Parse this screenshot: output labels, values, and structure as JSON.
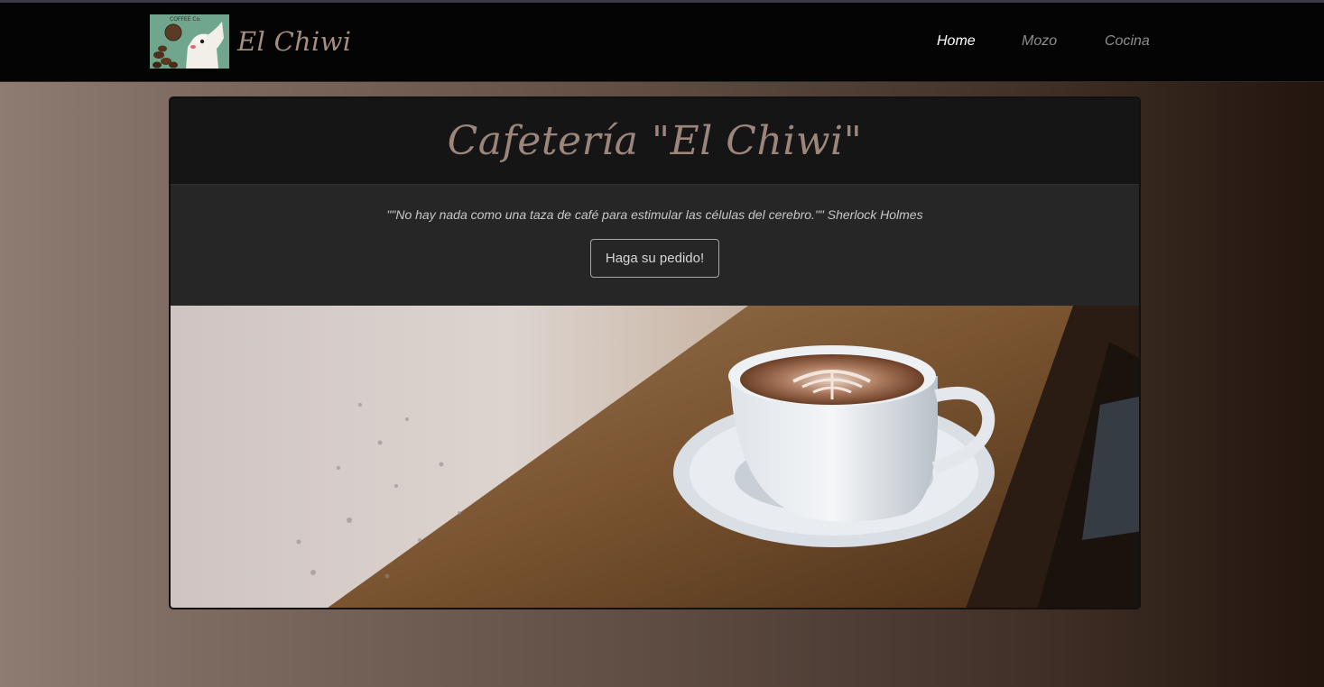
{
  "navbar": {
    "brand": "El Chiwi",
    "logo_text": "COFFEE Co.",
    "links": [
      {
        "label": "Home",
        "active": true
      },
      {
        "label": "Mozo",
        "active": false
      },
      {
        "label": "Cocina",
        "active": false
      }
    ]
  },
  "card": {
    "title": "Cafetería \"El Chiwi\"",
    "quote": "\"\"No hay nada como una taza de café para estimular las células del cerebro.\"\" Sherlock Holmes",
    "button_label": "Haga su pedido!",
    "hero_image": "coffee-cup-on-wooden-table-photo"
  },
  "colors": {
    "accent": "#a58e80",
    "navbar_bg": "#040404",
    "card_header_bg": "#151515",
    "card_body_bg": "#262626"
  }
}
